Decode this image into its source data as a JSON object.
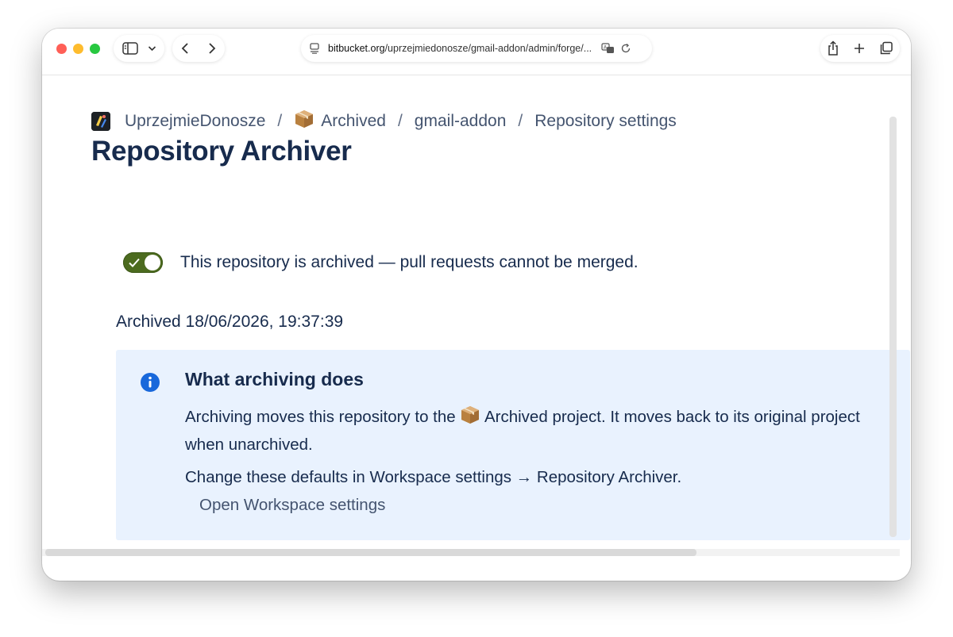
{
  "browser": {
    "url_host": "bitbucket.org",
    "url_path": "/uprzejmiedonosze/gmail-addon/admin/forge/...",
    "icons": [
      "sidebar-icon",
      "chevron-down-icon",
      "back-icon",
      "forward-icon",
      "page-icon",
      "translate-icon",
      "reload-icon",
      "share-icon",
      "plus-icon",
      "tabs-icon"
    ]
  },
  "breadcrumb": {
    "workspace": "UprzejmieDonosze",
    "sep1": "/",
    "project": "Archived",
    "sep2": "/",
    "repo": "gmail-addon",
    "sep3": "/",
    "settings": "Repository settings"
  },
  "page": {
    "title": "Repository Archiver"
  },
  "toggle": {
    "state": "on",
    "label": "This repository is archived — pull requests cannot be merged."
  },
  "archived_date": "Archived 18/06/2026, 19:37:39",
  "info": {
    "title": "What archiving does",
    "text_part1": "Archiving moves this repository to the",
    "project_name": "Archived",
    "text_part2": "project. It moves back to its original project",
    "text_line2": "when unarchived.",
    "defaults_text": "Change these defaults in Workspace settings → Repository Archiver.",
    "link": "Open Workspace settings"
  },
  "colors": {
    "toggle_on": "#4c6b1f",
    "info_background": "#e9f2fe",
    "info_icon": "#1868db",
    "text": "#172b4d",
    "subtle_text": "#44546f"
  }
}
